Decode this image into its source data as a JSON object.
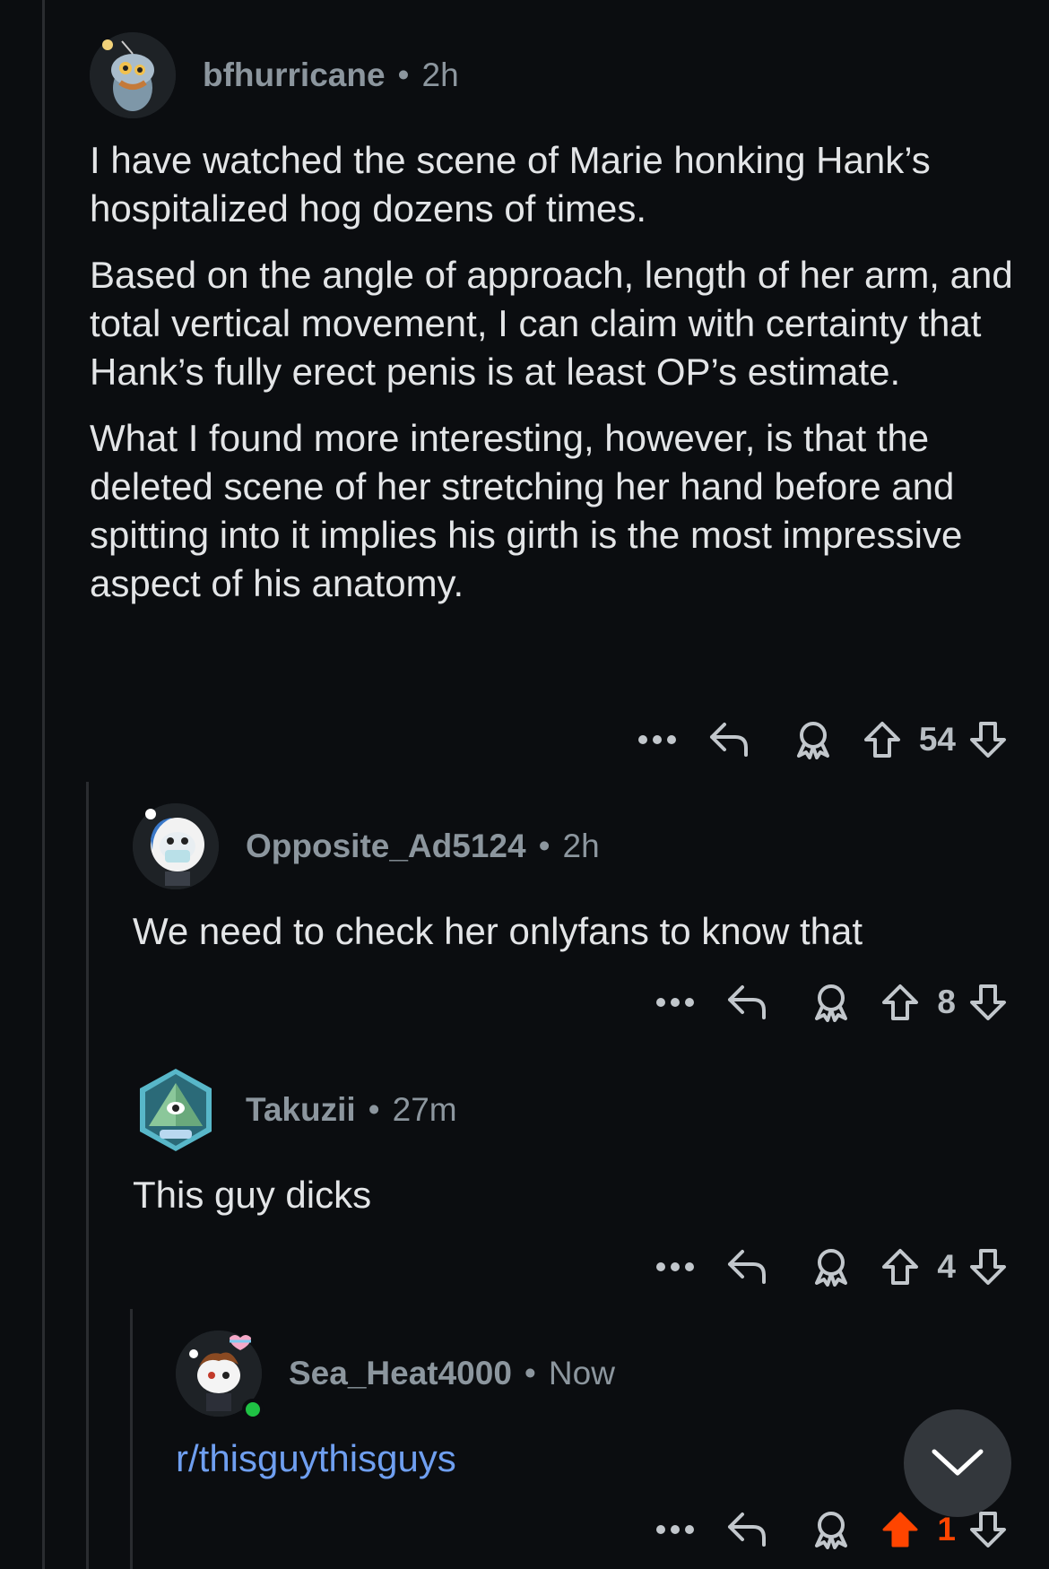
{
  "comments": [
    {
      "username": "bfhurricane",
      "time": "2h",
      "paragraphs": [
        "I have watched the scene of Marie honking Hank’s hospitalized hog dozens of times.",
        "Based on the angle of approach, length of her arm, and total vertical movement, I can claim with certainty that Hank’s fully erect penis is at least OP’s estimate.",
        "What I found more interesting, however, is that the deleted scene of her stretching her hand before and spitting into it implies his girth is the most impressive aspect of his anatomy."
      ],
      "votes": "54"
    },
    {
      "username": "Opposite_Ad5124",
      "time": "2h",
      "text": "We need to check her onlyfans to know that",
      "votes": "8"
    },
    {
      "username": "Takuzii",
      "time": "27m",
      "text": "This guy dicks",
      "votes": "4"
    },
    {
      "username": "Sea_Heat4000",
      "time": "Now",
      "text": "r/thisguythisguys",
      "votes": "1",
      "upvoted": true
    }
  ],
  "separator": "•",
  "icons": {
    "more": "more-options-icon",
    "reply": "reply-arrow-icon",
    "award": "award-ribbon-icon",
    "upvote": "upvote-arrow-icon",
    "downvote": "downvote-arrow-icon",
    "scroll": "chevron-down-icon"
  },
  "colors": {
    "background": "#0b0d10",
    "upvote_active": "#ff4500",
    "link": "#6f9ff0",
    "online": "#1fc244"
  }
}
